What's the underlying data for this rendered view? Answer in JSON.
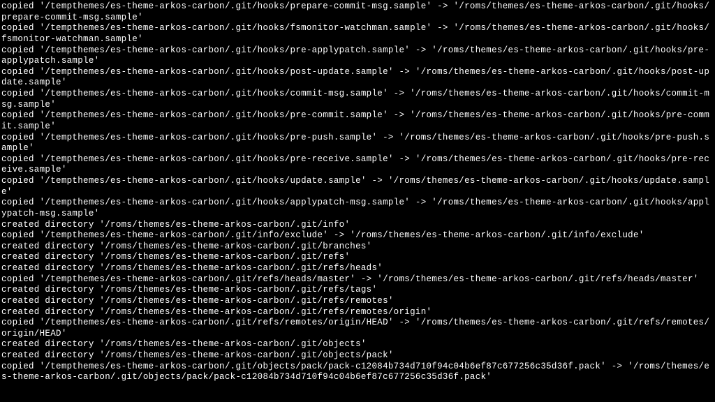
{
  "lines": [
    "copied '/tempthemes/es-theme-arkos-carbon/.git/hooks/prepare-commit-msg.sample' -> '/roms/themes/es-theme-arkos-carbon/.git/hooks/prepare-commit-msg.sample'",
    "copied '/tempthemes/es-theme-arkos-carbon/.git/hooks/fsmonitor-watchman.sample' -> '/roms/themes/es-theme-arkos-carbon/.git/hooks/fsmonitor-watchman.sample'",
    "copied '/tempthemes/es-theme-arkos-carbon/.git/hooks/pre-applypatch.sample' -> '/roms/themes/es-theme-arkos-carbon/.git/hooks/pre-applypatch.sample'",
    "copied '/tempthemes/es-theme-arkos-carbon/.git/hooks/post-update.sample' -> '/roms/themes/es-theme-arkos-carbon/.git/hooks/post-update.sample'",
    "copied '/tempthemes/es-theme-arkos-carbon/.git/hooks/commit-msg.sample' -> '/roms/themes/es-theme-arkos-carbon/.git/hooks/commit-msg.sample'",
    "copied '/tempthemes/es-theme-arkos-carbon/.git/hooks/pre-commit.sample' -> '/roms/themes/es-theme-arkos-carbon/.git/hooks/pre-commit.sample'",
    "copied '/tempthemes/es-theme-arkos-carbon/.git/hooks/pre-push.sample' -> '/roms/themes/es-theme-arkos-carbon/.git/hooks/pre-push.sample'",
    "copied '/tempthemes/es-theme-arkos-carbon/.git/hooks/pre-receive.sample' -> '/roms/themes/es-theme-arkos-carbon/.git/hooks/pre-receive.sample'",
    "copied '/tempthemes/es-theme-arkos-carbon/.git/hooks/update.sample' -> '/roms/themes/es-theme-arkos-carbon/.git/hooks/update.sample'",
    "copied '/tempthemes/es-theme-arkos-carbon/.git/hooks/applypatch-msg.sample' -> '/roms/themes/es-theme-arkos-carbon/.git/hooks/applypatch-msg.sample'",
    "created directory '/roms/themes/es-theme-arkos-carbon/.git/info'",
    "copied '/tempthemes/es-theme-arkos-carbon/.git/info/exclude' -> '/roms/themes/es-theme-arkos-carbon/.git/info/exclude'",
    "created directory '/roms/themes/es-theme-arkos-carbon/.git/branches'",
    "created directory '/roms/themes/es-theme-arkos-carbon/.git/refs'",
    "created directory '/roms/themes/es-theme-arkos-carbon/.git/refs/heads'",
    "copied '/tempthemes/es-theme-arkos-carbon/.git/refs/heads/master' -> '/roms/themes/es-theme-arkos-carbon/.git/refs/heads/master'",
    "created directory '/roms/themes/es-theme-arkos-carbon/.git/refs/tags'",
    "created directory '/roms/themes/es-theme-arkos-carbon/.git/refs/remotes'",
    "created directory '/roms/themes/es-theme-arkos-carbon/.git/refs/remotes/origin'",
    "copied '/tempthemes/es-theme-arkos-carbon/.git/refs/remotes/origin/HEAD' -> '/roms/themes/es-theme-arkos-carbon/.git/refs/remotes/origin/HEAD'",
    "created directory '/roms/themes/es-theme-arkos-carbon/.git/objects'",
    "created directory '/roms/themes/es-theme-arkos-carbon/.git/objects/pack'",
    "copied '/tempthemes/es-theme-arkos-carbon/.git/objects/pack/pack-c12084b734d710f94c04b6ef87c677256c35d36f.pack' -> '/roms/themes/es-theme-arkos-carbon/.git/objects/pack/pack-c12084b734d710f94c04b6ef87c677256c35d36f.pack'"
  ]
}
